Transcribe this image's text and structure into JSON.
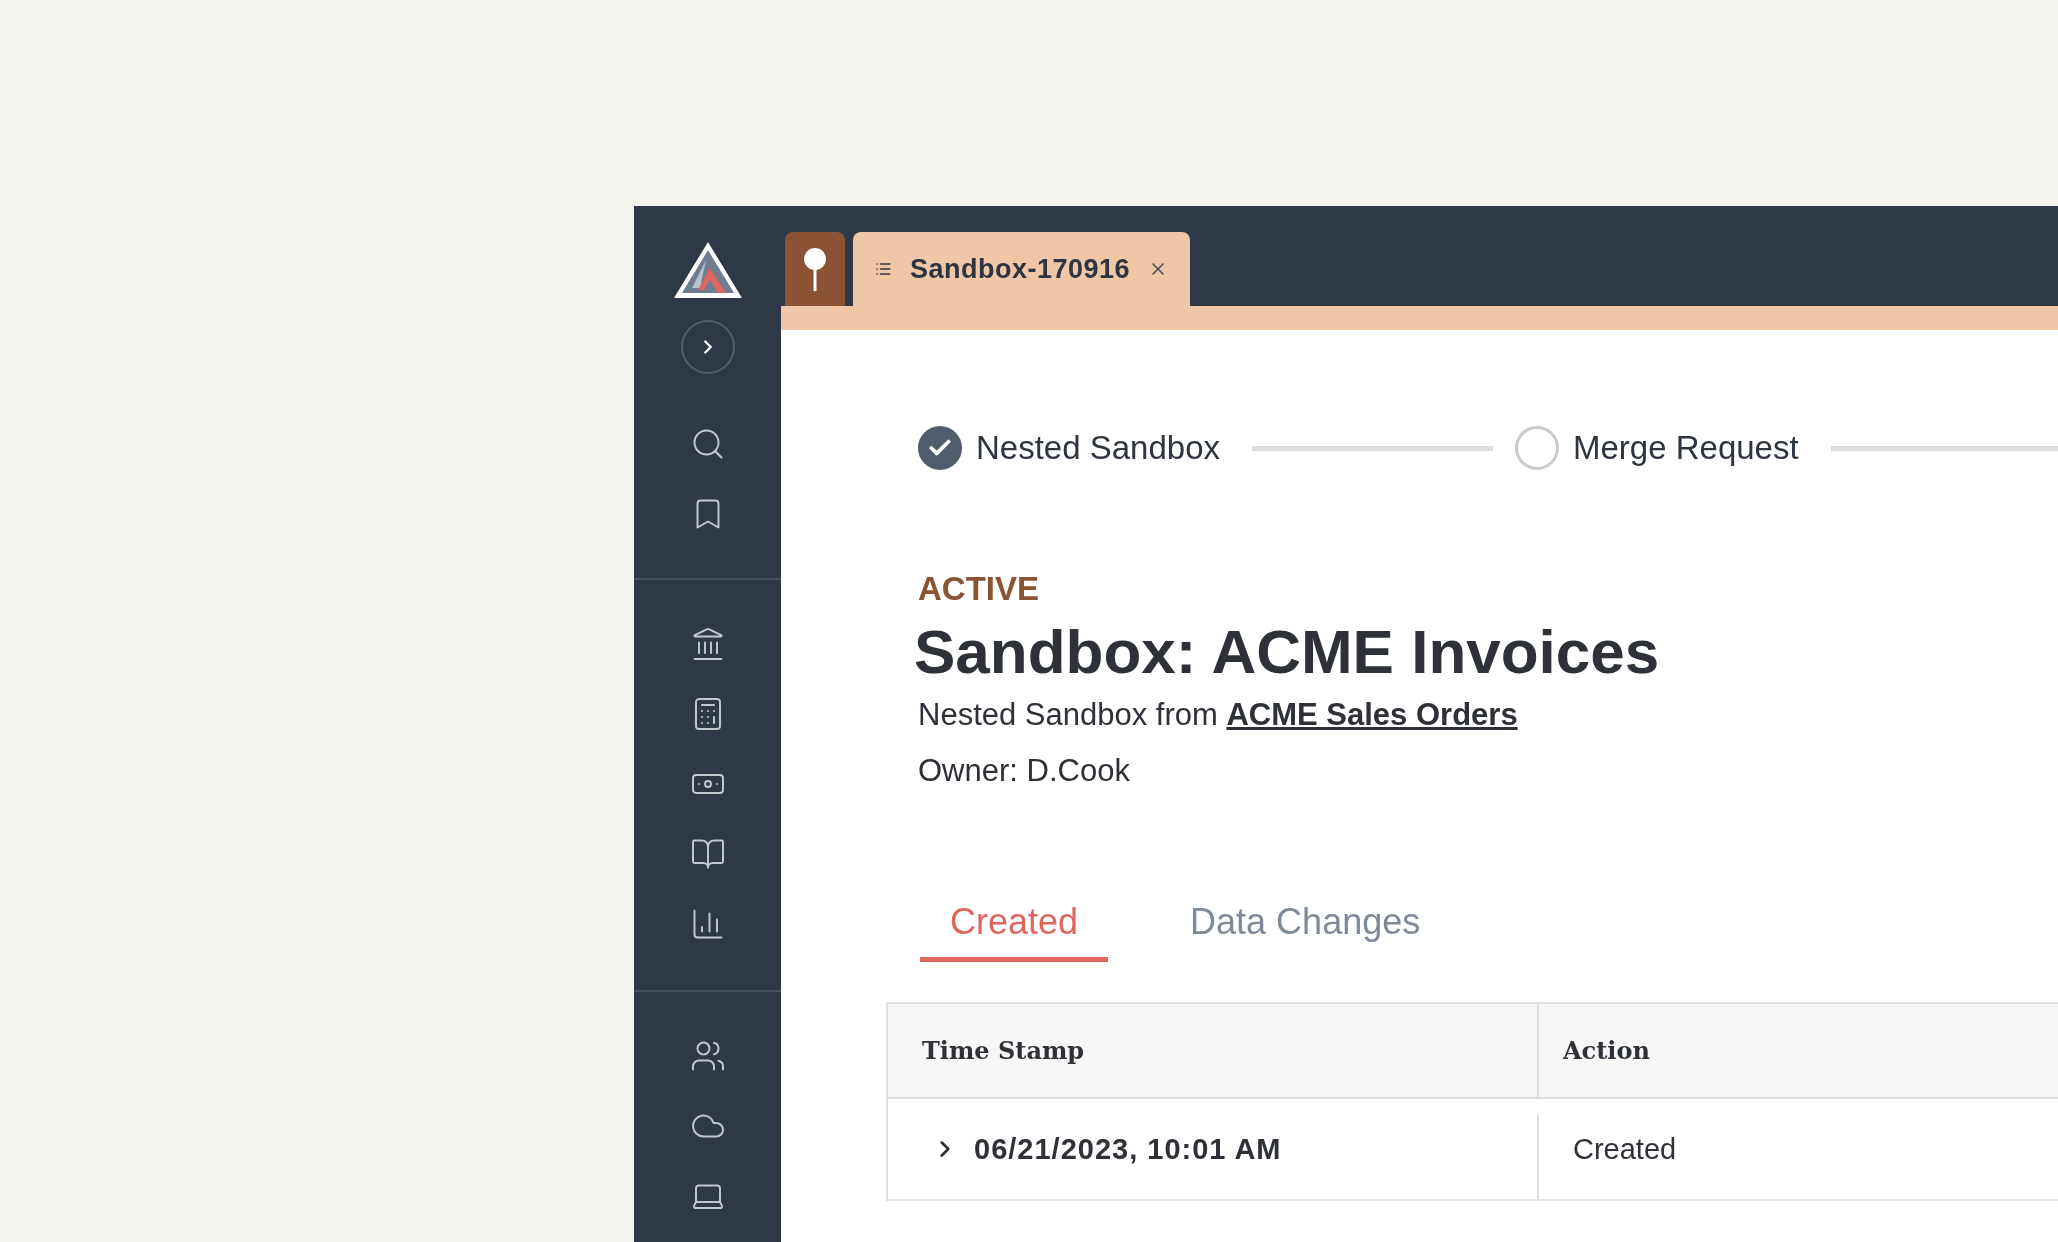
{
  "document_tab": {
    "title": "Sandbox-170916"
  },
  "steps": [
    {
      "label": "Nested Sandbox",
      "completed": true
    },
    {
      "label": "Merge Request",
      "completed": false
    }
  ],
  "status": "ACTIVE",
  "title": "Sandbox: ACME Invoices",
  "subtitle": {
    "text": "Nested Sandbox from",
    "link": "ACME Sales Orders"
  },
  "owner": "Owner: D.Cook",
  "tabs": [
    {
      "label": "Created",
      "selected": true
    },
    {
      "label": "Data Changes",
      "selected": false
    }
  ],
  "table": {
    "columns": [
      "Time Stamp",
      "Action"
    ],
    "rows": [
      {
        "time": "06/21/2023, 10:01 AM",
        "action": "Created",
        "expanded": false
      }
    ]
  }
}
